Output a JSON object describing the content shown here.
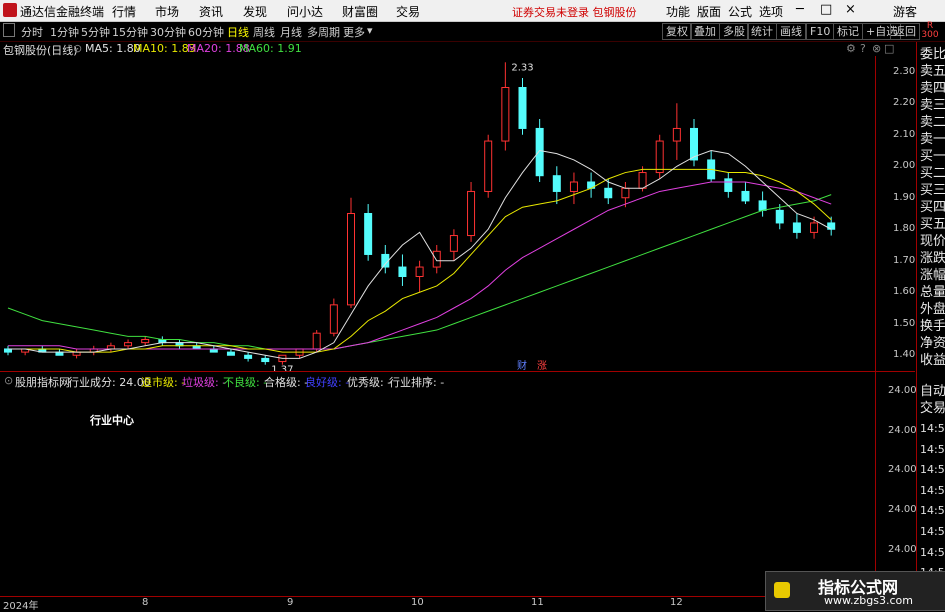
{
  "titlebar": {
    "app_title": "通达信金融终端",
    "menus": [
      "行情",
      "市场",
      "资讯",
      "发现",
      "问小达",
      "财富圈",
      "交易"
    ],
    "warning": "证券交易未登录  包钢股份",
    "tools": [
      "功能",
      "版面",
      "公式",
      "选项"
    ],
    "user": "游客"
  },
  "toolbar": {
    "periods": [
      "分时",
      "1分钟",
      "5分钟",
      "15分钟",
      "30分钟",
      "60分钟",
      "日线",
      "周线",
      "月线",
      "多周期",
      "更多"
    ],
    "active_period": "日线",
    "right_buttons": [
      "复权",
      "叠加",
      "多股",
      "统计",
      "画线",
      "F10",
      "标记",
      "+自选",
      "返回"
    ]
  },
  "chart": {
    "stock_title": "包钢股份(日线)",
    "ma": [
      {
        "label": "MA5: 1.80",
        "color": "#e0e0e0"
      },
      {
        "label": "MA10: 1.83",
        "color": "#e8e800"
      },
      {
        "label": "MA20: 1.88",
        "color": "#e040e0"
      },
      {
        "label": "MA60: 1.91",
        "color": "#40e040"
      }
    ],
    "y_ticks": [
      "2.30",
      "2.20",
      "2.10",
      "2.00",
      "1.90",
      "1.80",
      "1.70",
      "1.60",
      "1.50",
      "1.40"
    ],
    "high_label": "2.33",
    "low_label": "1.37",
    "markers": [
      "财",
      "涨"
    ],
    "ylim": [
      1.35,
      2.35
    ]
  },
  "indicator": {
    "name": "股朋指标网",
    "items": [
      {
        "label": "行业成分: 24.00",
        "color": "#e0e0e0"
      },
      {
        "label": "退市级: -",
        "color": "#e8e800"
      },
      {
        "label": "垃圾级: -",
        "color": "#e040e0"
      },
      {
        "label": "不良级: -",
        "color": "#40e040"
      },
      {
        "label": "合格级: -",
        "color": "#e0e0e0"
      },
      {
        "label": "良好级: -",
        "color": "#4040ff"
      },
      {
        "label": "优秀级: -",
        "color": "#e0e0e0"
      },
      {
        "label": "行业排序: -",
        "color": "#e0e0e0"
      }
    ],
    "sub_text": "行业中心",
    "y_ticks": [
      "24.00",
      "24.00",
      "24.00",
      "24.00",
      "24.00"
    ]
  },
  "sidebar": {
    "top_label": "R",
    "top_sub": "300",
    "items": [
      "委比",
      "卖五",
      "卖四",
      "卖三",
      "卖二",
      "卖一",
      "买一",
      "买二",
      "买三",
      "买四",
      "买五",
      "现价",
      "涨跌",
      "涨幅",
      "总量",
      "外盘",
      "换手",
      "净资",
      "收益",
      "自动",
      "交易",
      "14:56",
      "14:56",
      "14:56",
      "14:56",
      "14:56",
      "14:56",
      "14:56",
      "14:56"
    ]
  },
  "xaxis": {
    "labels": [
      "2024年",
      "8",
      "9",
      "10",
      "11",
      "12"
    ]
  },
  "watermark": {
    "title": "指标公式网",
    "url": "www.zbgs3.com"
  },
  "colors": {
    "up": "#ff3232",
    "down": "#54fcfc",
    "ma5": "#e0e0e0",
    "ma10": "#e8e800",
    "ma20": "#e040e0",
    "ma60": "#40e040",
    "border": "#a00000"
  },
  "chart_data": {
    "type": "candlestick",
    "x": [
      "2024-07",
      "2024-08",
      "2024-09",
      "2024-10",
      "2024-11",
      "2024-12"
    ],
    "ohlc": [
      [
        1.42,
        1.43,
        1.4,
        1.41
      ],
      [
        1.41,
        1.42,
        1.4,
        1.42
      ],
      [
        1.42,
        1.43,
        1.41,
        1.41
      ],
      [
        1.41,
        1.42,
        1.4,
        1.4
      ],
      [
        1.4,
        1.42,
        1.39,
        1.41
      ],
      [
        1.41,
        1.43,
        1.4,
        1.42
      ],
      [
        1.42,
        1.44,
        1.41,
        1.43
      ],
      [
        1.43,
        1.45,
        1.42,
        1.44
      ],
      [
        1.44,
        1.46,
        1.43,
        1.45
      ],
      [
        1.45,
        1.46,
        1.43,
        1.44
      ],
      [
        1.44,
        1.45,
        1.42,
        1.43
      ],
      [
        1.43,
        1.44,
        1.42,
        1.42
      ],
      [
        1.42,
        1.43,
        1.41,
        1.41
      ],
      [
        1.41,
        1.42,
        1.4,
        1.4
      ],
      [
        1.4,
        1.41,
        1.38,
        1.39
      ],
      [
        1.39,
        1.4,
        1.37,
        1.38
      ],
      [
        1.38,
        1.4,
        1.37,
        1.4
      ],
      [
        1.4,
        1.42,
        1.39,
        1.42
      ],
      [
        1.42,
        1.48,
        1.41,
        1.47
      ],
      [
        1.47,
        1.58,
        1.46,
        1.56
      ],
      [
        1.56,
        1.9,
        1.55,
        1.85
      ],
      [
        1.85,
        1.88,
        1.7,
        1.72
      ],
      [
        1.72,
        1.75,
        1.66,
        1.68
      ],
      [
        1.68,
        1.72,
        1.62,
        1.65
      ],
      [
        1.65,
        1.7,
        1.6,
        1.68
      ],
      [
        1.68,
        1.75,
        1.66,
        1.73
      ],
      [
        1.73,
        1.8,
        1.7,
        1.78
      ],
      [
        1.78,
        1.95,
        1.76,
        1.92
      ],
      [
        1.92,
        2.1,
        1.9,
        2.08
      ],
      [
        2.08,
        2.33,
        2.05,
        2.25
      ],
      [
        2.25,
        2.28,
        2.1,
        2.12
      ],
      [
        2.12,
        2.15,
        1.95,
        1.97
      ],
      [
        1.97,
        2.0,
        1.88,
        1.92
      ],
      [
        1.92,
        1.98,
        1.88,
        1.95
      ],
      [
        1.95,
        1.98,
        1.9,
        1.93
      ],
      [
        1.93,
        1.96,
        1.88,
        1.9
      ],
      [
        1.9,
        1.95,
        1.87,
        1.93
      ],
      [
        1.93,
        2.0,
        1.92,
        1.98
      ],
      [
        1.98,
        2.1,
        1.96,
        2.08
      ],
      [
        2.08,
        2.2,
        2.02,
        2.12
      ],
      [
        2.12,
        2.15,
        2.0,
        2.02
      ],
      [
        2.02,
        2.05,
        1.95,
        1.96
      ],
      [
        1.96,
        1.98,
        1.9,
        1.92
      ],
      [
        1.92,
        1.95,
        1.88,
        1.89
      ],
      [
        1.89,
        1.92,
        1.84,
        1.86
      ],
      [
        1.86,
        1.88,
        1.8,
        1.82
      ],
      [
        1.82,
        1.85,
        1.77,
        1.79
      ],
      [
        1.79,
        1.84,
        1.77,
        1.82
      ],
      [
        1.82,
        1.84,
        1.78,
        1.8
      ]
    ],
    "ma5": [
      1.42,
      1.42,
      1.41,
      1.41,
      1.41,
      1.41,
      1.42,
      1.42,
      1.43,
      1.44,
      1.44,
      1.44,
      1.43,
      1.42,
      1.41,
      1.4,
      1.39,
      1.39,
      1.41,
      1.44,
      1.53,
      1.62,
      1.69,
      1.75,
      1.79,
      1.7,
      1.7,
      1.74,
      1.8,
      1.9,
      1.98,
      2.05,
      2.04,
      2.02,
      1.99,
      1.95,
      1.93,
      1.93,
      1.96,
      2.0,
      2.03,
      2.05,
      2.04,
      2.0,
      1.95,
      1.9,
      1.85,
      1.83,
      1.8
    ],
    "ma10": [
      1.42,
      1.42,
      1.42,
      1.42,
      1.41,
      1.41,
      1.41,
      1.42,
      1.42,
      1.43,
      1.43,
      1.43,
      1.43,
      1.43,
      1.42,
      1.42,
      1.41,
      1.41,
      1.41,
      1.42,
      1.46,
      1.51,
      1.54,
      1.58,
      1.6,
      1.62,
      1.66,
      1.72,
      1.78,
      1.84,
      1.87,
      1.88,
      1.89,
      1.91,
      1.93,
      1.96,
      1.98,
      1.99,
      1.99,
      1.99,
      1.99,
      1.99,
      1.98,
      1.98,
      1.97,
      1.95,
      1.92,
      1.88,
      1.83
    ],
    "ma20": [
      1.43,
      1.43,
      1.43,
      1.43,
      1.42,
      1.42,
      1.42,
      1.42,
      1.42,
      1.42,
      1.42,
      1.42,
      1.42,
      1.42,
      1.42,
      1.42,
      1.42,
      1.42,
      1.42,
      1.42,
      1.43,
      1.44,
      1.46,
      1.48,
      1.5,
      1.52,
      1.55,
      1.58,
      1.62,
      1.67,
      1.71,
      1.74,
      1.77,
      1.8,
      1.83,
      1.86,
      1.88,
      1.9,
      1.92,
      1.93,
      1.94,
      1.95,
      1.95,
      1.95,
      1.94,
      1.93,
      1.92,
      1.9,
      1.88
    ],
    "ma60": [
      1.55,
      1.53,
      1.51,
      1.5,
      1.49,
      1.48,
      1.47,
      1.46,
      1.46,
      1.45,
      1.45,
      1.44,
      1.44,
      1.43,
      1.43,
      1.42,
      1.42,
      1.42,
      1.42,
      1.42,
      1.43,
      1.44,
      1.45,
      1.46,
      1.47,
      1.48,
      1.5,
      1.52,
      1.54,
      1.56,
      1.58,
      1.6,
      1.62,
      1.64,
      1.66,
      1.68,
      1.7,
      1.72,
      1.74,
      1.76,
      1.78,
      1.8,
      1.82,
      1.84,
      1.86,
      1.87,
      1.88,
      1.89,
      1.91
    ],
    "ylim": [
      1.35,
      2.35
    ],
    "title": "包钢股份(日线)"
  }
}
